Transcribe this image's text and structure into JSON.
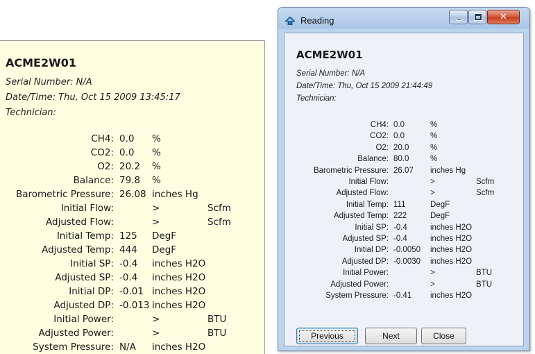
{
  "left_panel": {
    "title": "ACME2W01",
    "serial": "Serial Number: N/A",
    "datetime": "Date/Time: Thu, Oct 15 2009 13:45:17",
    "technician": "Technician:",
    "rows": [
      {
        "label": "CH4:",
        "value": "0.0",
        "unit": "%",
        "unit2": ""
      },
      {
        "label": "CO2:",
        "value": "0.0",
        "unit": "%",
        "unit2": ""
      },
      {
        "label": "O2:",
        "value": "20.2",
        "unit": "%",
        "unit2": ""
      },
      {
        "label": "Balance:",
        "value": "79.8",
        "unit": "%",
        "unit2": ""
      },
      {
        "label": "Barometric Pressure:",
        "value": "26.08",
        "unit": "inches Hg",
        "unit2": ""
      },
      {
        "label": "Initial Flow:",
        "value": "",
        "unit": ">",
        "unit2": "Scfm"
      },
      {
        "label": "Adjusted Flow:",
        "value": "",
        "unit": ">",
        "unit2": "Scfm"
      },
      {
        "label": "Initial Temp:",
        "value": "125",
        "unit": "DegF",
        "unit2": ""
      },
      {
        "label": "Adjusted Temp:",
        "value": "444",
        "unit": "DegF",
        "unit2": ""
      },
      {
        "label": "Initial SP:",
        "value": "-0.4",
        "unit": "inches H2O",
        "unit2": ""
      },
      {
        "label": "Adjusted SP:",
        "value": "-0.4",
        "unit": "inches H2O",
        "unit2": ""
      },
      {
        "label": "Initial DP:",
        "value": "-0.01",
        "unit": "inches H2O",
        "unit2": ""
      },
      {
        "label": "Adjusted DP:",
        "value": "-0.013",
        "unit": "inches H2O",
        "unit2": ""
      },
      {
        "label": "Initial Power:",
        "value": "",
        "unit": ">",
        "unit2": "BTU"
      },
      {
        "label": "Adjusted Power:",
        "value": "",
        "unit": ">",
        "unit2": "BTU"
      },
      {
        "label": "System Pressure:",
        "value": "N/A",
        "unit": "inches H2O",
        "unit2": ""
      }
    ]
  },
  "window": {
    "title": "Reading",
    "close_glyph": "✕",
    "heading": "ACME2W01",
    "serial": "Serial Number: N/A",
    "datetime": "Date/Time: Thu, Oct 15 2009 21:44:49",
    "technician": "Technician:",
    "rows": [
      {
        "label": "CH4:",
        "value": "0.0",
        "unit": "%",
        "unit2": ""
      },
      {
        "label": "CO2:",
        "value": "0.0",
        "unit": "%",
        "unit2": ""
      },
      {
        "label": "O2:",
        "value": "20.0",
        "unit": "%",
        "unit2": ""
      },
      {
        "label": "Balance:",
        "value": "80.0",
        "unit": "%",
        "unit2": ""
      },
      {
        "label": "Barometric Pressure:",
        "value": "26.07",
        "unit": "inches Hg",
        "unit2": ""
      },
      {
        "label": "Initial Flow:",
        "value": "",
        "unit": ">",
        "unit2": "Scfm"
      },
      {
        "label": "Adjusted Flow:",
        "value": "",
        "unit": ">",
        "unit2": "Scfm"
      },
      {
        "label": "Initial Temp:",
        "value": "111",
        "unit": "DegF",
        "unit2": ""
      },
      {
        "label": "Adjusted Temp:",
        "value": "222",
        "unit": "DegF",
        "unit2": ""
      },
      {
        "label": "Initial SP:",
        "value": "-0.4",
        "unit": "inches H2O",
        "unit2": ""
      },
      {
        "label": "Adjusted SP:",
        "value": "-0.4",
        "unit": "inches H2O",
        "unit2": ""
      },
      {
        "label": "Initial DP:",
        "value": "-0.0050",
        "unit": "inches H2O",
        "unit2": ""
      },
      {
        "label": "Adjusted DP:",
        "value": "-0.0030",
        "unit": "inches H2O",
        "unit2": ""
      },
      {
        "label": "Initial Power:",
        "value": "",
        "unit": ">",
        "unit2": "BTU"
      },
      {
        "label": "Adjusted Power:",
        "value": "",
        "unit": ">",
        "unit2": "BTU"
      },
      {
        "label": "System Pressure:",
        "value": "-0.41",
        "unit": "inches H2O",
        "unit2": ""
      }
    ],
    "buttons": {
      "previous": "Previous",
      "next": "Next",
      "close": "Close"
    }
  }
}
